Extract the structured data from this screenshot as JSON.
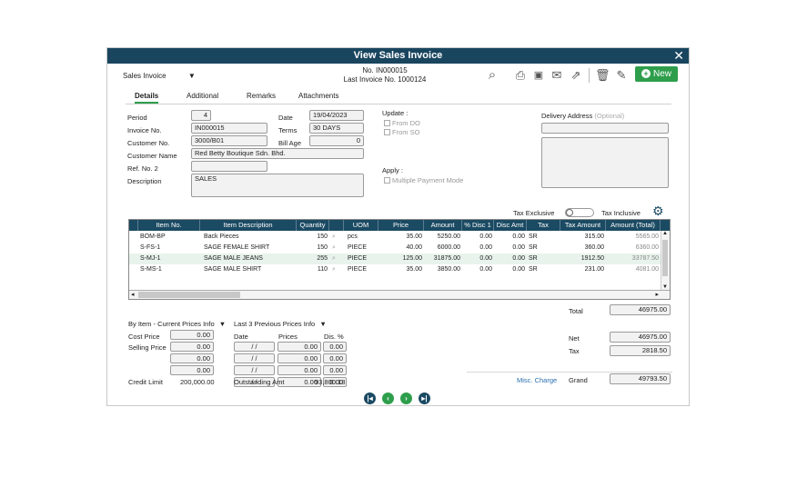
{
  "window": {
    "title": "View Sales Invoice"
  },
  "header": {
    "doc_type": "Sales Invoice",
    "doc_no": "No. IN000015",
    "last_invoice": "Last Invoice No. 1000124",
    "new_label": "New"
  },
  "tabs": [
    "Details",
    "Additional",
    "Remarks",
    "Attachments"
  ],
  "form": {
    "period_label": "Period",
    "period": "4",
    "invoice_no_label": "Invoice No.",
    "invoice_no": "IN000015",
    "customer_no_label": "Customer No.",
    "customer_no": "3000/B01",
    "customer_name_label": "Customer Name",
    "customer_name": "Red Betty Boutique Sdn. Bhd.",
    "ref_no_label": "Ref. No. 2",
    "ref_no": "",
    "description_label": "Description",
    "description": "SALES",
    "date_label": "Date",
    "date": "19/04/2023",
    "terms_label": "Terms",
    "terms": "30 DAYS",
    "bill_age_label": "Bill Age",
    "bill_age": "0",
    "update_label": "Update :",
    "from_do": "From DO",
    "from_so": "From SO",
    "apply_label": "Apply :",
    "multiple_payment": "Multiple Payment Mode",
    "delivery_label": "Delivery Address",
    "delivery_optional": "(Optional)"
  },
  "tax_toggle": {
    "exclusive": "Tax Exclusive",
    "inclusive": "Tax Inclusive"
  },
  "grid": {
    "columns": [
      "Item No.",
      "Item Description",
      "Quantity",
      "UOM",
      "Price",
      "Amount",
      "% Disc 1",
      "Disc Amt",
      "Tax",
      "Tax Amount",
      "Amount (Total)"
    ],
    "rows": [
      [
        "BOM-BP",
        "Back Pieces",
        "150",
        "pcs",
        "35.00",
        "5250.00",
        "0.00",
        "0.00",
        "SR",
        "315.00",
        "5565.00"
      ],
      [
        "S-FS-1",
        "SAGE FEMALE SHIRT",
        "150",
        "PIECE",
        "40.00",
        "6000.00",
        "0.00",
        "0.00",
        "SR",
        "360.00",
        "6360.00"
      ],
      [
        "S-MJ-1",
        "SAGE MALE JEANS",
        "255",
        "PIECE",
        "125.00",
        "31875.00",
        "0.00",
        "0.00",
        "SR",
        "1912.50",
        "33787.50"
      ],
      [
        "S-MS-1",
        "SAGE MALE SHIRT",
        "110",
        "PIECE",
        "35.00",
        "3850.00",
        "0.00",
        "0.00",
        "SR",
        "231.00",
        "4081.00"
      ]
    ]
  },
  "price_info": {
    "by_item": "By Item - Current Prices Info",
    "last3": "Last 3 Previous Prices Info",
    "cost_price_label": "Cost Price",
    "selling_price_label": "Selling Price",
    "prices": [
      "0.00",
      "0.00",
      "0.00",
      "0.00"
    ],
    "date_col": "Date",
    "prices_col": "Prices",
    "dis_col": "Dis. %",
    "hist": [
      {
        "date": "/ /",
        "price": "0.00",
        "dis": "0.00"
      },
      {
        "date": "/ /",
        "price": "0.00",
        "dis": "0.00"
      },
      {
        "date": "/ /",
        "price": "0.00",
        "dis": "0.00"
      },
      {
        "date": "/ /",
        "price": "0.00",
        "dis": "0.00"
      }
    ],
    "credit_limit_label": "Credit Limit",
    "credit_limit": "200,000.00",
    "outstanding_label": "Outstanding Amt",
    "outstanding": "93,800.18"
  },
  "totals": {
    "total_label": "Total",
    "total": "46975.00",
    "net_label": "Net",
    "net": "46975.00",
    "tax_label": "Tax",
    "tax": "2818.50",
    "misc_label": "Misc. Charge",
    "grand_label": "Grand",
    "grand": "49793.50"
  },
  "colors": {
    "titlebar": "#19455f",
    "accent": "#2e9e4c",
    "link": "#2a6fb0",
    "nav": "#2e9e4c"
  }
}
